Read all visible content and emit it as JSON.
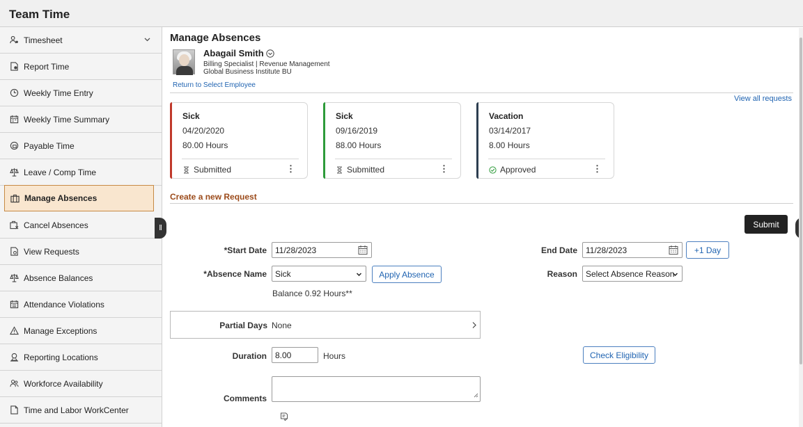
{
  "app": {
    "title": "Team Time"
  },
  "sidebar": {
    "items": [
      {
        "label": "Timesheet",
        "icon": "person-icon",
        "has_chevron": true
      },
      {
        "label": "Report Time",
        "icon": "report-icon"
      },
      {
        "label": "Weekly Time Entry",
        "icon": "clock-icon"
      },
      {
        "label": "Weekly Time Summary",
        "icon": "calendar-summary-icon"
      },
      {
        "label": "Payable Time",
        "icon": "payable-icon"
      },
      {
        "label": "Leave / Comp Time",
        "icon": "scale-icon"
      },
      {
        "label": "Manage Absences",
        "icon": "briefcase-icon",
        "active": true
      },
      {
        "label": "Cancel Absences",
        "icon": "cancel-briefcase-icon"
      },
      {
        "label": "View Requests",
        "icon": "document-search-icon"
      },
      {
        "label": "Absence Balances",
        "icon": "scale-icon"
      },
      {
        "label": "Attendance Violations",
        "icon": "calendar-icon"
      },
      {
        "label": "Manage Exceptions",
        "icon": "warning-icon"
      },
      {
        "label": "Reporting Locations",
        "icon": "location-icon"
      },
      {
        "label": "Workforce Availability",
        "icon": "people-icon"
      },
      {
        "label": "Time and Labor WorkCenter",
        "icon": "document-icon"
      }
    ]
  },
  "page": {
    "title": "Manage Absences",
    "employee": {
      "name": "Abagail Smith",
      "title_line": "Billing Specialist | Revenue Management",
      "org_line": "Global Business Institute BU",
      "return_link": "Return to Select Employee"
    },
    "view_all_link": "View all requests",
    "requests": [
      {
        "type": "Sick",
        "date": "04/20/2020",
        "hours": "80.00 Hours",
        "status": "Submitted",
        "status_icon": "hourglass-icon",
        "accent": "#c0392b"
      },
      {
        "type": "Sick",
        "date": "09/16/2019",
        "hours": "88.00 Hours",
        "status": "Submitted",
        "status_icon": "hourglass-icon",
        "accent": "#2e9b3a"
      },
      {
        "type": "Vacation",
        "date": "03/14/2017",
        "hours": "8.00 Hours",
        "status": "Approved",
        "status_icon": "check-circle-icon",
        "accent": "#2c3e50"
      }
    ],
    "kebab_glyph": "⋮",
    "new_request_title": "Create a new Request",
    "submit_label": "Submit"
  },
  "form": {
    "start_date_label": "*Start Date",
    "start_date_value": "11/28/2023",
    "end_date_label": "End Date",
    "end_date_value": "11/28/2023",
    "plus_day_label": "+1 Day",
    "absence_name_label": "*Absence Name",
    "absence_name_value": "Sick",
    "apply_absence_label": "Apply Absence",
    "reason_label": "Reason",
    "reason_value": "Select Absence Reason",
    "balance_text": "Balance  0.92 Hours**",
    "partial_days_label": "Partial Days",
    "partial_days_value": "None",
    "duration_label": "Duration",
    "duration_value": "8.00",
    "hours_unit": "Hours",
    "check_eligibility_label": "Check Eligibility",
    "comments_label": "Comments",
    "comments_value": ""
  },
  "colors": {
    "active_bg": "#f9e6cf",
    "active_border": "#c68a44",
    "link": "#1f63b1",
    "section": "#9b4a1a"
  }
}
